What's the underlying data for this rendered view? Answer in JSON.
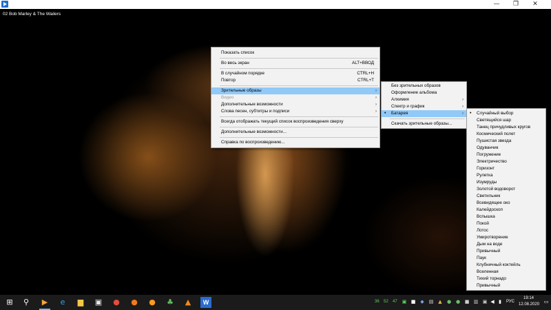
{
  "window": {
    "app_icon": "media-player-icon",
    "minimize_glyph": "—",
    "maximize_glyph": "❐",
    "close_glyph": "✕"
  },
  "track_title": "02 Bob Marley & The Wailers",
  "main_menu": {
    "items": [
      {
        "label": "Показать список",
        "shortcut": ""
      },
      {
        "label": "Во весь экран",
        "shortcut": "ALT+ВВОД"
      },
      {
        "label": "В случайном порядке",
        "shortcut": "CTRL+H"
      },
      {
        "label": "Повтор",
        "shortcut": "CTRL+T"
      },
      {
        "label": "Зрительные образы",
        "submenu": true,
        "state": "highlighted"
      },
      {
        "label": "Видео",
        "submenu": true,
        "state": "disabled"
      },
      {
        "label": "Дополнительные возможности",
        "submenu": true
      },
      {
        "label": "Слова песен, субтитры и подписи",
        "submenu": true
      },
      {
        "label": "Всегда отображать текущий список воспроизведения сверху"
      },
      {
        "label": "Дополнительные возможности..."
      },
      {
        "label": "Справка по воспроизведению..."
      }
    ]
  },
  "visuals_menu": {
    "items": [
      {
        "label": "Без зрительных образов"
      },
      {
        "label": "Оформление альбома"
      },
      {
        "label": "Алхимия",
        "submenu": true
      },
      {
        "label": "Спектр и график",
        "submenu": true
      },
      {
        "label": "Батарея",
        "submenu": true,
        "state": "highlighted",
        "checked": true
      },
      {
        "label": "Скачать зрительные образы..."
      }
    ]
  },
  "battery_menu": {
    "items": [
      {
        "label": "Случайный выбор",
        "checked": true
      },
      {
        "label": "Светящийся шар"
      },
      {
        "label": "Танец причудливых кругов"
      },
      {
        "label": "Космический полет"
      },
      {
        "label": "Пушистая звезда"
      },
      {
        "label": "Одуванчик"
      },
      {
        "label": "Погружение"
      },
      {
        "label": "Электричество"
      },
      {
        "label": "Горизонт"
      },
      {
        "label": "Рулетка"
      },
      {
        "label": "Изумруды"
      },
      {
        "label": "Золотой водоворот"
      },
      {
        "label": "Светильник"
      },
      {
        "label": "Всевидящее око"
      },
      {
        "label": "Калейдоскоп"
      },
      {
        "label": "Вспышка"
      },
      {
        "label": "Покой"
      },
      {
        "label": "Лотос"
      },
      {
        "label": "Умиротворение"
      },
      {
        "label": "Дым на воде"
      },
      {
        "label": "Привычный"
      },
      {
        "label": "Паук"
      },
      {
        "label": "Клубничный коктейль"
      },
      {
        "label": "Вселенная"
      },
      {
        "label": "Тихий торнадо"
      },
      {
        "label": "Привычный"
      }
    ]
  },
  "taskbar": {
    "start_glyph": "⊞",
    "search_glyph": "⚲",
    "apps": [
      {
        "name": "media-player-icon",
        "glyph": "▶",
        "color": "#f3a43a"
      },
      {
        "name": "edge-icon",
        "glyph": "e",
        "color": "#3aa0e0"
      },
      {
        "name": "file-explorer-icon",
        "glyph": "▆",
        "color": "#f6c645"
      },
      {
        "name": "store-icon",
        "glyph": "▣",
        "color": "#e8e8e8"
      },
      {
        "name": "chrome-icon",
        "glyph": "●",
        "color": "#e84a3b"
      },
      {
        "name": "firefox-icon",
        "glyph": "●",
        "color": "#f7771c"
      },
      {
        "name": "firefox-alt-icon",
        "glyph": "●",
        "color": "#ff9a1d"
      },
      {
        "name": "game-icon",
        "glyph": "♣",
        "color": "#5fbf5f"
      },
      {
        "name": "vlc-icon",
        "glyph": "▲",
        "color": "#f08a1c"
      },
      {
        "name": "word-icon",
        "glyph": "W",
        "color": "#2b6bd0"
      }
    ],
    "tray": {
      "temperature_1": "36",
      "temperature_2": "52",
      "temperature_3": "47",
      "language": "РУС",
      "time": "19:14",
      "date": "12.08.2020"
    }
  },
  "colors": {
    "menu_background": "#f2f2f2",
    "highlight": "#91c9f7",
    "disabled_text": "#9a9a9a",
    "taskbar": "#1b1b1b",
    "tray_green": "#5cd65c"
  }
}
